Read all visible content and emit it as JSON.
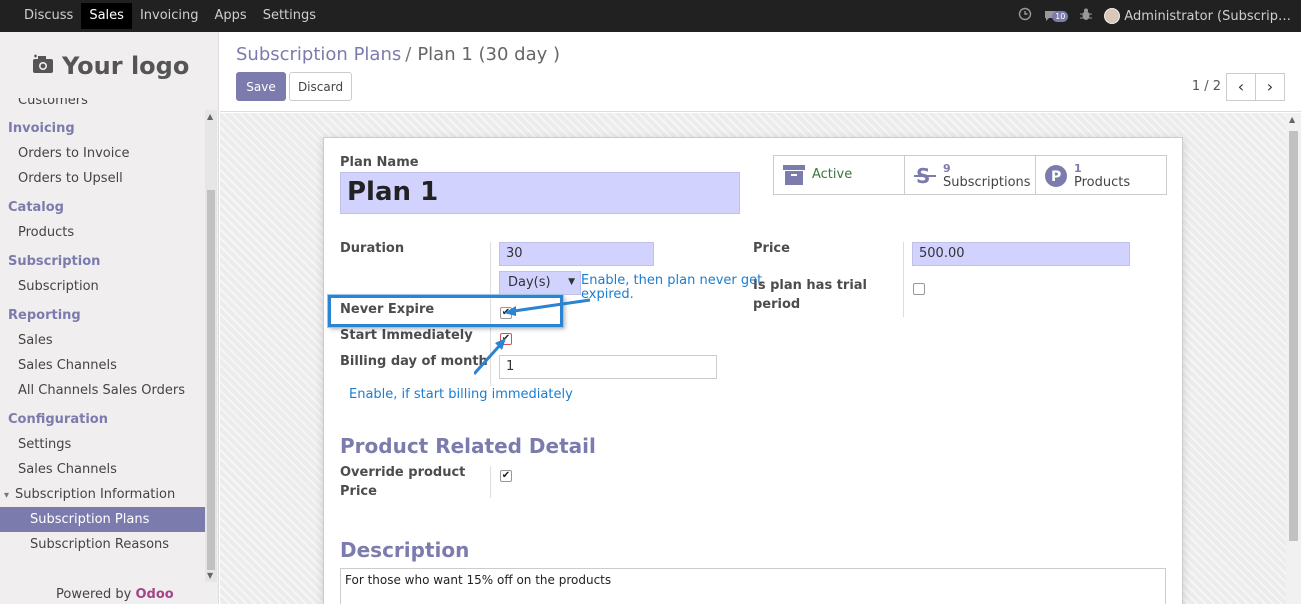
{
  "topbar": {
    "menu": [
      "Discuss",
      "Sales",
      "Invoicing",
      "Apps",
      "Settings"
    ],
    "active_menu": "Sales",
    "messages_count": "10",
    "user": "Administrator (Subscrip…"
  },
  "sidebar": {
    "logo_text": "Your logo",
    "cut_item": "Customers",
    "sections": [
      {
        "title": "Invoicing",
        "items": [
          "Orders to Invoice",
          "Orders to Upsell"
        ]
      },
      {
        "title": "Catalog",
        "items": [
          "Products"
        ]
      },
      {
        "title": "Subscription",
        "items": [
          "Subscription"
        ]
      },
      {
        "title": "Reporting",
        "items": [
          "Sales",
          "Sales Channels",
          "All Channels Sales Orders"
        ]
      },
      {
        "title": "Configuration",
        "items": [
          "Settings",
          "Sales Channels"
        ]
      }
    ],
    "parent_item": "Subscription Information",
    "sub_items": [
      "Subscription Plans",
      "Subscription Reasons"
    ],
    "powered_prefix": "Powered by",
    "powered_brand": "Odoo"
  },
  "control": {
    "breadcrumb_parent": "Subscription Plans",
    "breadcrumb_sep": "/",
    "breadcrumb_current": "Plan 1 (30 day )",
    "save_label": "Save",
    "discard_label": "Discard",
    "pager": "1 / 2"
  },
  "form": {
    "plan_name_label": "Plan Name",
    "plan_name": "Plan 1",
    "stat_active": "Active",
    "stat_subscriptions_count": "9",
    "stat_subscriptions_label": "Subscriptions",
    "stat_products_count": "1",
    "stat_products_label": "Products",
    "duration_label": "Duration",
    "duration_value": "30",
    "duration_unit": "Day(s)",
    "price_label": "Price",
    "price_value": "500.00",
    "trial_label_1": "Is plan has trial",
    "trial_label_2": "period",
    "never_expire_label": "Never Expire",
    "start_immediately_label": "Start Immediately",
    "billing_day_label": "Billing day of month",
    "billing_day_value": "1",
    "product_section": "Product Related Detail",
    "override_label_1": "Override product",
    "override_label_2": "Price",
    "description_section": "Description",
    "description_text": "For those who want 15% off on the products"
  },
  "annotations": {
    "never_expire_note_1": "Enable, then plan never get",
    "never_expire_note_2": "expired.",
    "start_note": "Enable, if start billing immediately"
  },
  "colors": {
    "accent": "#7c7bad",
    "field_bg": "#d2d2ff",
    "annotation": "#1a7dd0",
    "active_green": "#3c763d"
  }
}
